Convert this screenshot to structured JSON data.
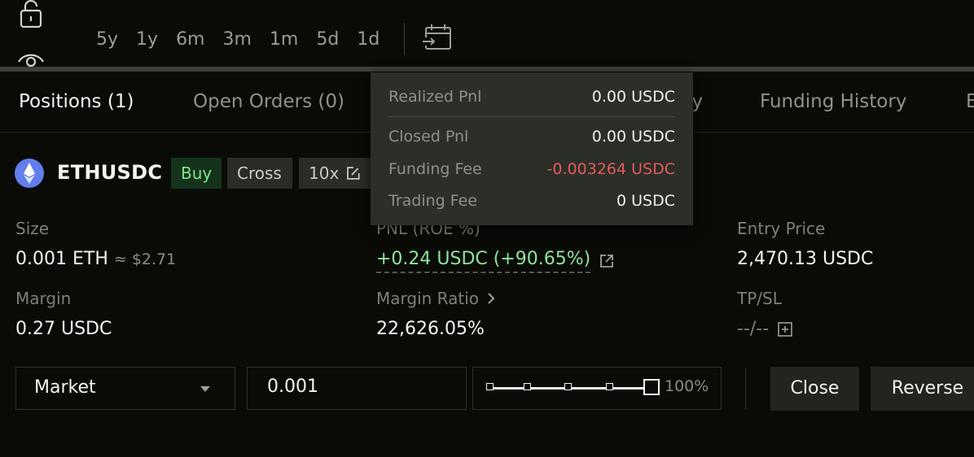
{
  "timeframes": [
    "5y",
    "1y",
    "6m",
    "3m",
    "1m",
    "5d",
    "1d"
  ],
  "icons": {
    "lock": "unlock-icon",
    "eye": "eye-icon",
    "calendar": "calendar-range-icon"
  },
  "tabs": [
    {
      "label": "Positions (1)",
      "active": true
    },
    {
      "label": "Open Orders (0)",
      "active": false
    },
    {
      "label": "ry",
      "active": false
    },
    {
      "label": "Funding History",
      "active": false
    },
    {
      "label": "E",
      "active": false
    }
  ],
  "position": {
    "symbol": "ETHUSDC",
    "side_badge": "Buy",
    "margin_mode_badge": "Cross",
    "leverage_badge": "10x",
    "size_label": "Size",
    "size_value": "0.001 ETH",
    "size_usd": "≈ $2.71",
    "pnl_label": "PNL (ROE %)",
    "pnl_value": "+0.24 USDC (+90.65%)",
    "entry_label": "Entry Price",
    "entry_value": "2,470.13 USDC",
    "margin_label": "Margin",
    "margin_value": "0.27 USDC",
    "margin_ratio_label": "Margin Ratio",
    "margin_ratio_value": "22,626.05%",
    "tpsl_label": "TP/SL",
    "tpsl_value": "--/--"
  },
  "order_controls": {
    "order_type": "Market",
    "quantity": "0.001",
    "slider_percent": "100%",
    "slider_fraction": 1.0,
    "close_label": "Close",
    "reverse_label": "Reverse"
  },
  "pnl_tooltip": {
    "rows": [
      {
        "label": "Realized Pnl",
        "value": "0.00 USDC",
        "negative": false
      },
      {
        "label": "Closed Pnl",
        "value": "0.00 USDC",
        "negative": false
      },
      {
        "label": "Funding Fee",
        "value": "-0.003264 USDC",
        "negative": true
      },
      {
        "label": "Trading Fee",
        "value": "0 USDC",
        "negative": false
      }
    ]
  },
  "colors": {
    "background": "#0a0b07",
    "positive": "#8ee49a",
    "negative": "#e35a58",
    "buy_badge_bg": "#15331a",
    "eth_brand": "#627eea"
  }
}
